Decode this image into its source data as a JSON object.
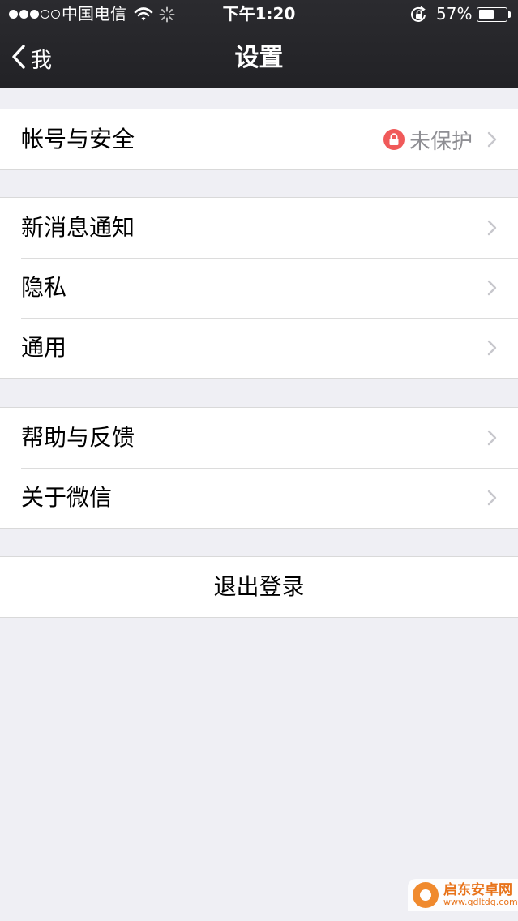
{
  "status_bar": {
    "carrier": "中国电信",
    "time": "下午1:20",
    "battery_percent_label": "57%",
    "battery_level": 0.57,
    "signal_bars_filled": 3,
    "signal_bars_total": 5,
    "icons": [
      "wifi-icon",
      "activity-spinner-icon",
      "rotation-lock-icon",
      "battery-icon"
    ]
  },
  "nav": {
    "back_label": "我",
    "title": "设置"
  },
  "groups": [
    {
      "rows": [
        {
          "label": "帐号与安全",
          "detail": "未保护",
          "detail_icon": "lock-icon",
          "chevron": true
        }
      ]
    },
    {
      "rows": [
        {
          "label": "新消息通知",
          "chevron": true
        },
        {
          "label": "隐私",
          "chevron": true
        },
        {
          "label": "通用",
          "chevron": true
        }
      ]
    },
    {
      "rows": [
        {
          "label": "帮助与反馈",
          "chevron": true
        },
        {
          "label": "关于微信",
          "chevron": true
        }
      ]
    }
  ],
  "logout": {
    "label": "退出登录"
  },
  "watermark": {
    "title": "启东安卓网",
    "url": "www.qdltdq.com"
  },
  "colors": {
    "nav_background": "#222226",
    "page_background": "#efeff4",
    "lock_badge": "#f05a5a",
    "detail_text": "#8e8e93",
    "chevron": "#c7c7cc"
  }
}
